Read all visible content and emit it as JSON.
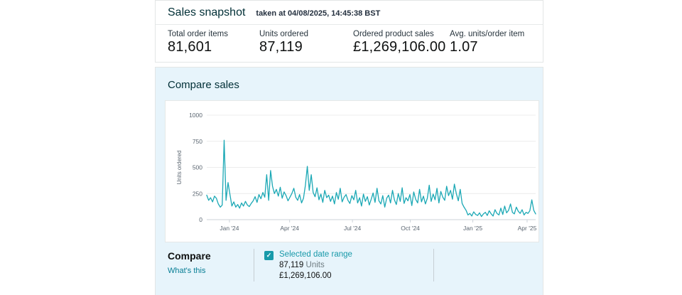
{
  "snapshot": {
    "title": "Sales snapshot",
    "taken_at": "taken at 04/08/2025, 14:45:38 BST",
    "metrics": [
      {
        "label": "Total order items",
        "value": "81,601"
      },
      {
        "label": "Units ordered",
        "value": "87,119"
      },
      {
        "label": "Ordered product sales",
        "value": "£1,269,106.00"
      },
      {
        "label": "Avg. units/order item",
        "value": "1.07"
      }
    ]
  },
  "compare": {
    "title": "Compare sales",
    "heading": "Compare",
    "whats_this_link": "What's this",
    "legend": {
      "checked": true,
      "label": "Selected date range",
      "units_value": "87,119",
      "units_suffix": "Units",
      "sales_value": "£1,269,106.00"
    }
  },
  "icons": {
    "checkmark": "✓"
  },
  "colors": {
    "accent_teal_line": "#1ba8b5",
    "checkbox_teal": "#189aaa",
    "link_teal": "#067d94",
    "legend_label_teal": "#1899a9",
    "section_bg_blue": "#e7f4fb",
    "heading_dark": "#002f36",
    "text_dark": "#0f1111"
  },
  "chart_data": {
    "type": "line",
    "title": "Compare sales",
    "xlabel": "",
    "ylabel": "Units ordered",
    "ylim": [
      0,
      1000
    ],
    "y_ticks": [
      0,
      250,
      500,
      750,
      1000
    ],
    "grid": "horizontal",
    "x_ticks": [
      {
        "label": "Jan '24",
        "pos": 0.069
      },
      {
        "label": "Apr '24",
        "pos": 0.252
      },
      {
        "label": "Jul '24",
        "pos": 0.443
      },
      {
        "label": "Oct '24",
        "pos": 0.619
      },
      {
        "label": "Jan '25",
        "pos": 0.809
      },
      {
        "label": "Apr '25",
        "pos": 0.974
      }
    ],
    "series": [
      {
        "name": "Selected date range",
        "color": "#1ba8b5",
        "values": [
          235,
          185,
          210,
          170,
          225,
          205,
          150,
          120,
          140,
          760,
          185,
          355,
          240,
          130,
          170,
          120,
          145,
          110,
          160,
          130,
          175,
          140,
          125,
          155,
          180,
          220,
          165,
          240,
          200,
          260,
          215,
          430,
          185,
          470,
          320,
          250,
          290,
          225,
          310,
          205,
          265,
          230,
          180,
          215,
          250,
          300,
          215,
          185,
          240,
          160,
          205,
          330,
          510,
          280,
          430,
          260,
          220,
          305,
          190,
          245,
          165,
          280,
          210,
          235,
          175,
          225,
          150,
          260,
          195,
          300,
          170,
          215,
          240,
          185,
          155,
          230,
          190,
          280,
          160,
          210,
          130,
          245,
          175,
          220,
          140,
          195,
          255,
          165,
          300,
          180,
          150,
          230,
          120,
          205,
          235,
          160,
          280,
          190,
          145,
          250,
          175,
          305,
          155,
          210,
          180,
          240,
          135,
          265,
          195,
          160,
          290,
          170,
          225,
          150,
          205,
          330,
          175,
          245,
          190,
          300,
          160,
          270,
          215,
          185,
          320,
          230,
          280,
          195,
          340,
          250,
          180,
          290,
          155,
          120,
          90,
          45,
          60,
          35,
          75,
          50,
          40,
          65,
          30,
          55,
          70,
          40,
          85,
          55,
          35,
          95,
          60,
          45,
          110,
          50,
          130,
          65,
          90,
          150,
          70,
          55,
          120,
          80,
          60,
          95,
          45,
          70,
          60,
          85,
          190,
          90,
          55
        ]
      }
    ]
  }
}
